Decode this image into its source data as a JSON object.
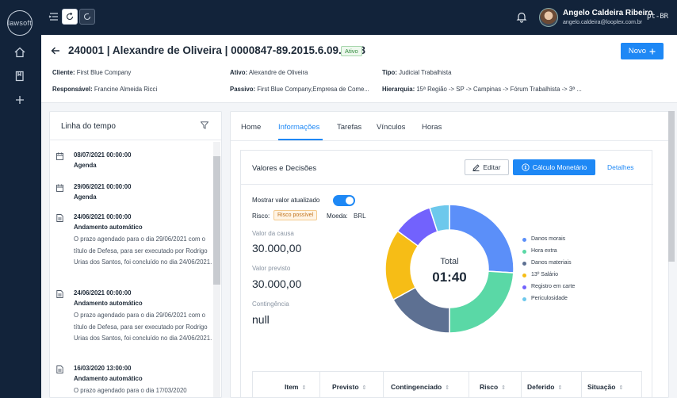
{
  "app": {
    "logo_text": "lawsoft"
  },
  "user": {
    "name": "Angelo Caldeira Ribeiro",
    "email": "angelo.caldeira@looplex.com.br",
    "lang": "pt-BR"
  },
  "case": {
    "title": "240001 | Alexandre de Oliveira | 0000847-89.2015.6.09.1478",
    "status": "Ativo",
    "new_button": "Novo",
    "meta": [
      {
        "label": "Cliente:",
        "value": "First Blue Company"
      },
      {
        "label": "Ativo:",
        "value": "Alexandre de Oliveira"
      },
      {
        "label": "Tipo:",
        "value": "Judicial Trabalhista"
      },
      {
        "label": "Responsável:",
        "value": "Francine Almeida Ricci"
      },
      {
        "label": "Passivo:",
        "value": "First Blue Company,Empresa de Come..."
      },
      {
        "label": "Hierarquia:",
        "value": "15ª Região -> SP -> Campinas -> Fórum Trabalhista -> 3ª ..."
      }
    ]
  },
  "timeline": {
    "title": "Linha do tempo",
    "items": [
      {
        "icon": "calendar-icon",
        "date": "08/07/2021 00:00:00",
        "type": "Agenda",
        "desc": ""
      },
      {
        "icon": "calendar-icon",
        "date": "29/06/2021 00:00:00",
        "type": "Agenda",
        "desc": ""
      },
      {
        "icon": "document-icon",
        "date": "24/06/2021 00:00:00",
        "type": "Andamento automático",
        "desc": "O prazo agendado para o dia 29/06/2021 com o título de Defesa, para ser executado por Rodrigo Urias dos Santos, foi concluído no dia 24/06/2021."
      },
      {
        "icon": "document-icon",
        "date": "24/06/2021 00:00:00",
        "type": "Andamento automático",
        "desc": "O prazo agendado para o dia 29/06/2021 com o título de Defesa, para ser executado por Rodrigo Urias dos Santos, foi concluído no dia 24/06/2021."
      },
      {
        "icon": "document-icon",
        "date": "16/03/2020 13:00:00",
        "type": "Andamento automático",
        "desc": "O prazo agendado para o dia 17/03/2020"
      }
    ]
  },
  "tabs": [
    "Home",
    "Informações",
    "Tarefas",
    "Vínculos",
    "Horas"
  ],
  "active_tab": "Informações",
  "values": {
    "title": "Valores e Decisões",
    "edit_button": "Editar",
    "calc_button": "Cálculo Monetário",
    "details_link": "Detalhes",
    "toggle_label": "Mostrar valor atualizado",
    "toggle_on": true,
    "risk_label": "Risco:",
    "risk_value": "Risco possível",
    "currency_label": "Moeda:",
    "currency_value": "BRL",
    "cause_label": "Valor da causa",
    "cause_value": "30.000,00",
    "expected_label": "Valor previsto",
    "expected_value": "30.000,00",
    "contingency_label": "Contingência",
    "contingency_value": "null",
    "total_label": "Total",
    "total_value": "01:40"
  },
  "chart_data": {
    "type": "pie",
    "categories": [
      "Danos morais",
      "Hora extra",
      "Danos materiais",
      "13º Salário",
      "Registro em carte",
      "Periculosidade"
    ],
    "values": [
      26,
      24,
      17,
      18,
      10,
      5
    ],
    "colors": [
      "#5b8ff9",
      "#5ad8a6",
      "#5d7092",
      "#f6bd16",
      "#7262fd",
      "#6dc8ec"
    ]
  },
  "table": {
    "columns": [
      "Item",
      "Previsto",
      "Contingenciado",
      "Risco",
      "Deferido",
      "Situação"
    ]
  }
}
